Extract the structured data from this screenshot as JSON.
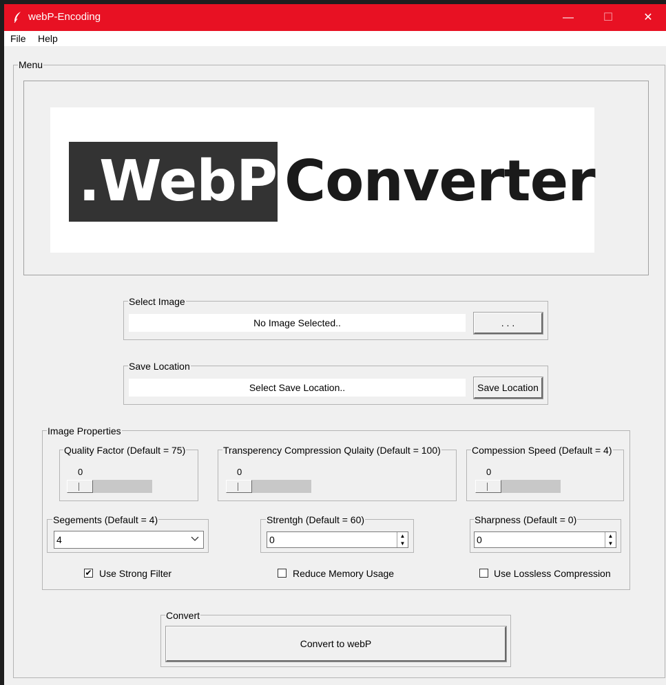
{
  "window": {
    "title": "webP-Encoding",
    "minimize": "—",
    "maximize": "☐",
    "close": "✕",
    "icon": "feather-icon"
  },
  "menubar": {
    "items": [
      "File",
      "Help"
    ]
  },
  "menu_frame": {
    "label": "Menu"
  },
  "logo": {
    "left_text": ".WebP",
    "right_text": "Converter"
  },
  "select_image": {
    "label": "Select Image",
    "value": "No Image Selected..",
    "button": ". . ."
  },
  "save_location": {
    "label": "Save Location",
    "value": "Select Save Location..",
    "button": "Save Location"
  },
  "image_properties": {
    "label": "Image Properties",
    "quality": {
      "label": "Quality Factor (Default = 75)",
      "value": "0"
    },
    "transparency": {
      "label": "Transperency Compression Qulaity (Default = 100)",
      "value": "0"
    },
    "speed": {
      "label": "Compession Speed (Default = 4)",
      "value": "0"
    },
    "segments": {
      "label": "Segements (Default = 4)",
      "value": "4"
    },
    "strength": {
      "label": "Strentgh (Default = 60)",
      "value": "0"
    },
    "sharpness": {
      "label": "Sharpness (Default = 0)",
      "value": "0"
    },
    "strong_filter": {
      "label": "Use Strong Filter",
      "checked": true
    },
    "reduce_memory": {
      "label": "Reduce Memory Usage",
      "checked": false
    },
    "lossless": {
      "label": "Use Lossless Compression",
      "checked": false
    }
  },
  "convert": {
    "label": "Convert",
    "button": "Convert to webP"
  }
}
